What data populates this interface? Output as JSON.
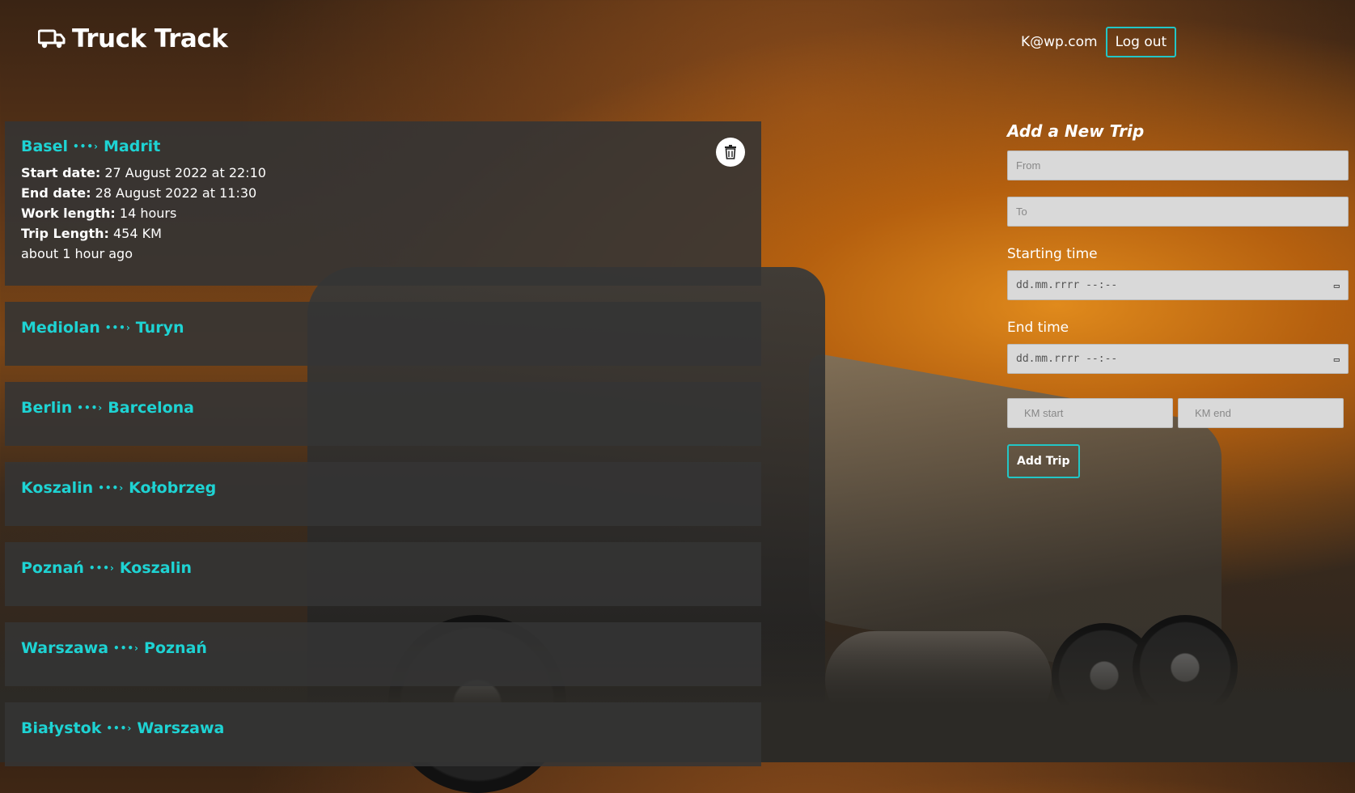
{
  "header": {
    "brand": "Truck Track",
    "logo_icon": "truck-icon",
    "user_email": "K@wp.com",
    "logout_label": "Log out"
  },
  "trips": [
    {
      "from": "Basel",
      "to": "Madrit",
      "expanded": true,
      "start_label": "Start date:",
      "start_value": "27 August 2022 at 22:10",
      "end_label": "End date:",
      "end_value": "28 August 2022 at 11:30",
      "work_label": "Work length:",
      "work_value": "14 hours",
      "length_label": "Trip Length:",
      "length_value": "454 KM",
      "relative_time": "about 1 hour ago"
    },
    {
      "from": "Mediolan",
      "to": "Turyn"
    },
    {
      "from": "Berlin",
      "to": "Barcelona"
    },
    {
      "from": "Koszalin",
      "to": "Kołobrzeg"
    },
    {
      "from": "Poznań",
      "to": "Koszalin"
    },
    {
      "from": "Warszawa",
      "to": "Poznań"
    },
    {
      "from": "Białystok",
      "to": "Warszawa"
    }
  ],
  "form": {
    "title": "Add a New Trip",
    "from_placeholder": "From",
    "to_placeholder": "To",
    "start_label": "Starting time",
    "start_placeholder": "dd.mm.rrrr --:--",
    "end_label": "End time",
    "end_placeholder": "dd.mm.rrrr --:--",
    "km_start_placeholder": "KM start",
    "km_end_placeholder": "KM end",
    "submit_label": "Add Trip"
  },
  "colors": {
    "accent": "#1ed3d3",
    "card_bg": "#343434",
    "input_bg": "#d9d9d9"
  }
}
